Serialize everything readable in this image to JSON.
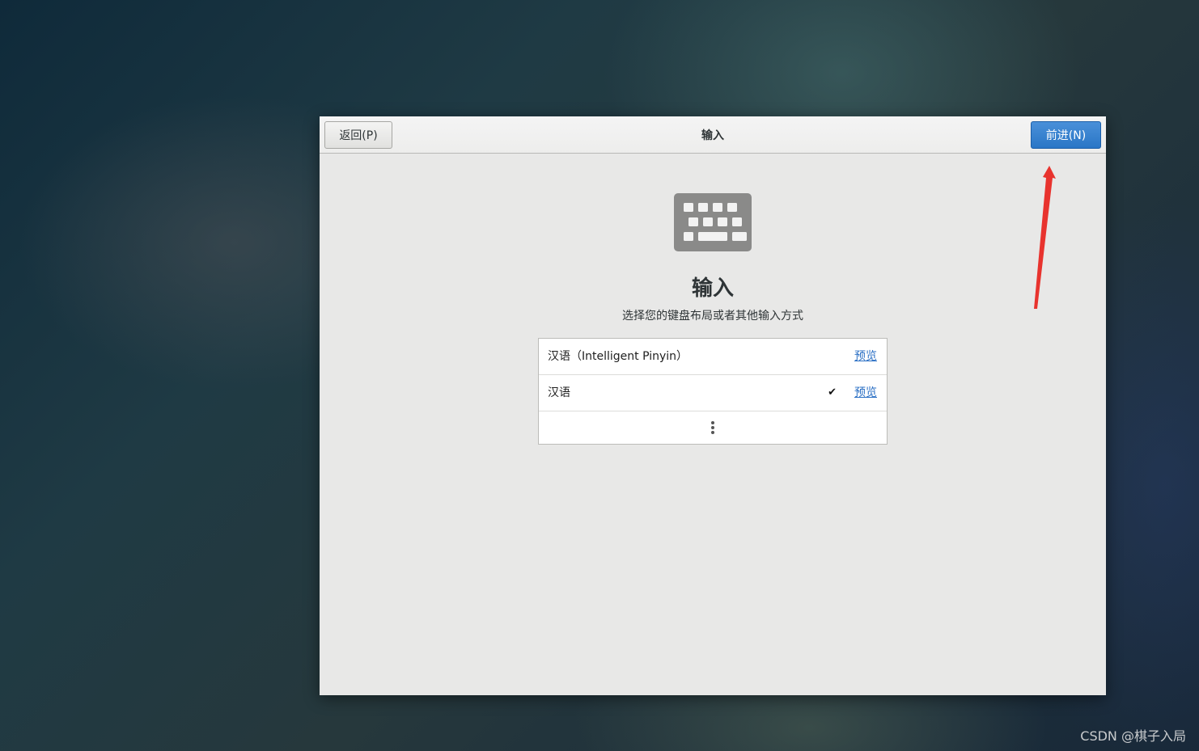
{
  "header": {
    "back_label": "返回(P)",
    "title": "输入",
    "next_label": "前进(N)"
  },
  "page": {
    "heading": "输入",
    "subtitle": "选择您的键盘布局或者其他输入方式",
    "icon": "keyboard-icon"
  },
  "input_sources": [
    {
      "label": "汉语（Intelligent Pinyin）",
      "preview_label": "预览",
      "selected": false
    },
    {
      "label": "汉语",
      "preview_label": "预览",
      "selected": true
    }
  ],
  "more_icon": "vertical-ellipsis-icon",
  "check_glyph": "✔",
  "watermark": "CSDN @棋子入局",
  "colors": {
    "accent": "#2a76c6",
    "link": "#2a6fc4",
    "annotation_arrow": "#e8332e"
  }
}
